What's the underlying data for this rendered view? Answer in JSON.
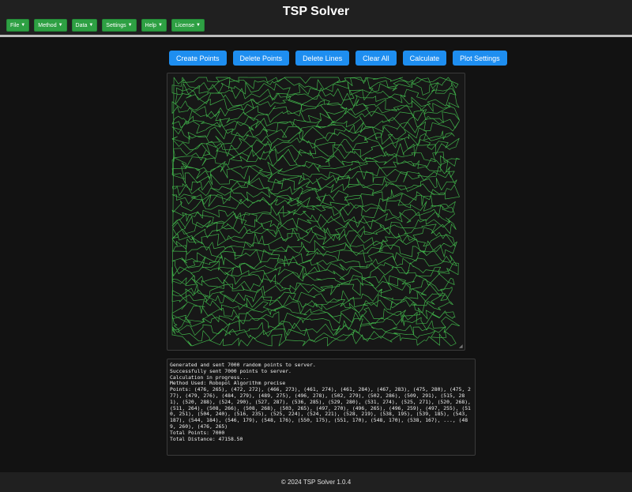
{
  "app": {
    "title": "TSP Solver"
  },
  "menu": [
    {
      "label": "File",
      "caret": "▼"
    },
    {
      "label": "Method",
      "caret": "▼"
    },
    {
      "label": "Data",
      "caret": "▼"
    },
    {
      "label": "Settings",
      "caret": "▼"
    },
    {
      "label": "Help",
      "caret": "▼"
    },
    {
      "label": "License",
      "caret": "▼"
    }
  ],
  "toolbar": {
    "create_points": "Create Points",
    "delete_points": "Delete Points",
    "delete_lines": "Delete Lines",
    "clear_all": "Clear All",
    "calculate": "Calculate",
    "plot_settings": "Plot Settings"
  },
  "plot": {
    "route_color": "#3fae49",
    "point_count": 7000
  },
  "log": {
    "lines": [
      "Generated and sent 7000 random points to server.",
      "Successfully sent 7000 points to server.",
      "Calculation in progress...",
      "Method Used: Robopol Algorithm precise",
      "Points: (476, 265), (472, 272), (466, 273), (461, 274), (461, 284), (467, 283), (475, 280), (475, 277), (479, 276), (484, 279), (489, 275), (496, 278), (502, 279), (502, 286), (509, 291), (515, 281), (520, 288), (524, 290), (527, 287), (536, 285), (529, 280), (531, 274), (525, 271), (520, 268), (511, 264), (508, 266), (508, 268), (503, 265), (497, 270), (496, 265), (496, 259), (497, 255), (510, 251), (504, 240), (516, 235), (525, 224), (524, 221), (528, 219), (538, 195), (539, 185), (543, 187), (544, 184), (546, 179), (548, 176), (550, 175), (551, 170), (548, 170), (538, 167), ..., (489, 260), (476, 265)",
      "Total Points: 7000",
      "Total Distance: 47158.50"
    ]
  },
  "footer": {
    "text": "© 2024 TSP Solver 1.0.4"
  }
}
